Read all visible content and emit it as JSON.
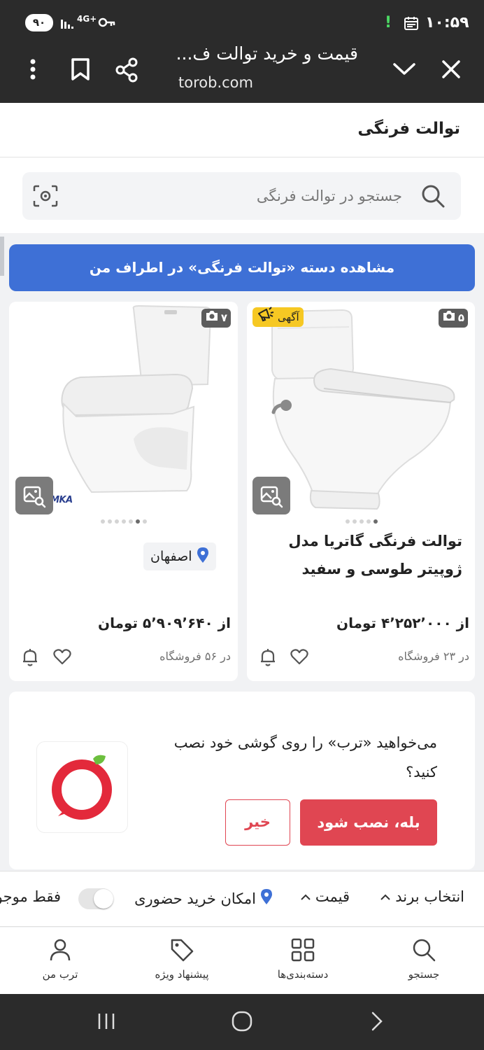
{
  "status_bar": {
    "battery": "۹۰",
    "time": "۱۰:۵۹",
    "network": "4G+"
  },
  "browser": {
    "page_title": "قیمت و خرید توالت ف...",
    "url": "torob.com",
    "icons": [
      "close-icon",
      "chevron-down-icon",
      "share-icon",
      "bookmark-icon",
      "more-vert-icon"
    ]
  },
  "category": {
    "title": "توالت فرنگی"
  },
  "search": {
    "placeholder": "جستجو در توالت فرنگی"
  },
  "near_me_button": "مشاهده دسته «توالت فرنگی» در اطراف من",
  "products": [
    {
      "photo_count": "۵",
      "ad_label": "آگهی",
      "title": "توالت فرنگی گاتریا مدل ژوپیتر طوسی و سفید",
      "price": "از ۴٬۲۵۲٬۰۰۰ تومان",
      "stores": "در ۲۳ فروشگاه"
    },
    {
      "photo_count": "۷",
      "city": "اصفهان",
      "price": "از ۵٬۹۰۹٬۶۴۰ تومان",
      "stores": "در ۵۶ فروشگاه",
      "brand_mark": "RAMKA"
    }
  ],
  "install_prompt": {
    "text": "می‌خواهید «ترب» را روی گوشی خود نصب کنید؟",
    "yes_label": "بله، نصب شود",
    "no_label": "خیر"
  },
  "filters": {
    "brand": "انتخاب برند",
    "price": "قیمت",
    "in_person": "امکان خرید حضوری",
    "only_available": "فقط موجود"
  },
  "bottom_nav": {
    "search": "جستجو",
    "categories": "دسته‌بندی‌ها",
    "special": "پیشنهاد ویژه",
    "my_torob": "ترب من"
  },
  "colors": {
    "primary_blue": "#3e70d6",
    "install_red": "#e04652",
    "ad_yellow": "#f6c823",
    "dark_bar": "#2b2b2b"
  }
}
